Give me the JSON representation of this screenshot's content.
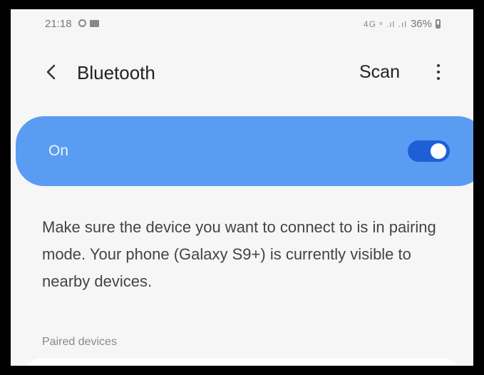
{
  "status_bar": {
    "time": "21:18",
    "network": "4G ⁿ .ıl .ıl",
    "battery": "36%"
  },
  "header": {
    "title": "Bluetooth",
    "scan_label": "Scan"
  },
  "bluetooth_toggle": {
    "label": "On",
    "enabled": true,
    "accent_color": "#5a9cf2"
  },
  "info_text": "Make sure the device you want to connect to is in pairing mode. Your phone (Galaxy S9+) is currently visible to nearby devices.",
  "paired_devices_header": "Paired devices"
}
